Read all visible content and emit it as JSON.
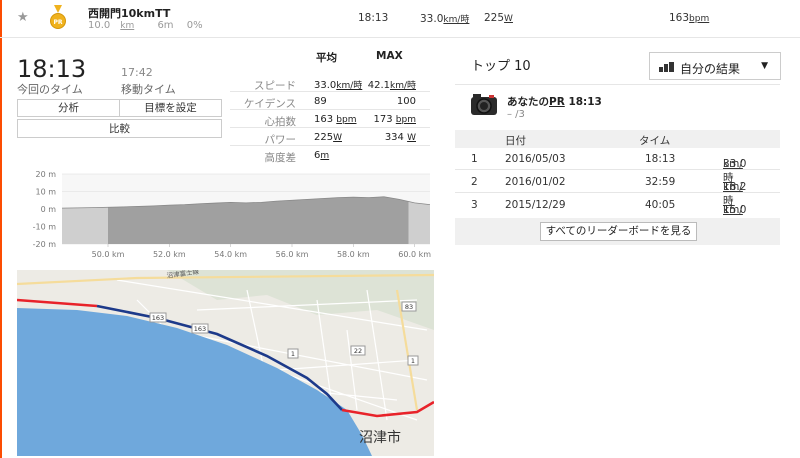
{
  "segment": {
    "name": "西開門10kmTT",
    "distance": "10.0",
    "distance_unit": "km",
    "elev_gain": "6m",
    "grade": "0%",
    "time": "18:13",
    "speed": "33.0",
    "speed_unit": "km/時",
    "power": "225",
    "power_unit": "W",
    "heart_rate": "163",
    "hr_unit": "bpm",
    "medal_label": "PR"
  },
  "summary": {
    "elapsed_time": "18:13",
    "elapsed_label": "今回のタイム",
    "moving_time": "17:42",
    "moving_label": "移動タイム",
    "buttons": {
      "analyze": "分析",
      "set_goal": "目標を設定",
      "compare": "比較"
    }
  },
  "stats": {
    "avg_header": "平均",
    "max_header": "MAX",
    "rows": [
      {
        "label": "スピード",
        "avg": "33.0",
        "avg_unit": "km/時",
        "max": "42.1",
        "max_unit": "km/時"
      },
      {
        "label": "ケイデンス",
        "avg": "89",
        "avg_unit": "",
        "max": "100",
        "max_unit": ""
      },
      {
        "label": "心拍数",
        "avg": "163",
        "avg_unit": "bpm",
        "max": "173",
        "max_unit": "bpm"
      },
      {
        "label": "パワー",
        "avg": "225",
        "avg_unit": "W",
        "max": "334",
        "max_unit": "W"
      },
      {
        "label": "高度差",
        "avg": "6",
        "avg_unit": "m",
        "max": "",
        "max_unit": ""
      }
    ]
  },
  "chart_data": {
    "type": "area",
    "x": [
      48.5,
      49.5,
      50.0,
      50.5,
      51.0,
      51.5,
      52.0,
      52.5,
      53.0,
      53.5,
      54.0,
      54.5,
      55.0,
      55.5,
      56.0,
      56.5,
      57.0,
      57.5,
      58.0,
      58.5,
      59.0,
      59.5,
      60.0,
      60.5
    ],
    "y": [
      0.5,
      0.8,
      1.0,
      1.2,
      1.5,
      1.8,
      2.2,
      2.5,
      3.0,
      3.4,
      3.8,
      3.5,
      3.8,
      4.5,
      5.0,
      5.5,
      6.0,
      6.5,
      6.8,
      6.5,
      7.0,
      5.5,
      3.5,
      2.5
    ],
    "xlabel": "",
    "ylabel": "",
    "xlim": [
      48.5,
      60.5
    ],
    "ylim": [
      -20,
      20
    ],
    "x_ticks": [
      "50.0 km",
      "52.0 km",
      "54.0 km",
      "56.0 km",
      "58.0 km",
      "60.0 km"
    ],
    "y_ticks": [
      "20 m",
      "10 m",
      "0 m",
      "-10 m",
      "-20 m"
    ],
    "highlight_range": [
      50.0,
      59.8
    ],
    "grid": true,
    "fill_color": "#a0a0a0",
    "context_color": "#cfcfcf"
  },
  "map": {
    "labels": [
      "163",
      "163",
      "1",
      "22",
      "83",
      "1"
    ],
    "city": "沼津市",
    "road_label": "沼津富士線",
    "route_color": "#1d3a8a",
    "offroute_color": "#e8232a",
    "sea_color": "#6fa8dc"
  },
  "leaderboard": {
    "title": "トップ 10",
    "dropdown": "自分の結果",
    "pr_title_prefix": "あなたの",
    "pr_word": "PR",
    "pr_time": "18:13",
    "pr_rank": "– /3",
    "headers": {
      "date": "日付",
      "time": "タイム"
    },
    "rows": [
      {
        "rank": "1",
        "date": "2016/05/03",
        "time": "18:13",
        "speed": "33.0",
        "unit": "km/時"
      },
      {
        "rank": "2",
        "date": "2016/01/02",
        "time": "32:59",
        "speed": "18.2",
        "unit": "km/時"
      },
      {
        "rank": "3",
        "date": "2015/12/29",
        "time": "40:05",
        "speed": "15.0",
        "unit": "km/時"
      }
    ],
    "view_all": "すべてのリーダーボードを見る"
  },
  "colors": {
    "accent": "#fc4c02",
    "medal": "#f0b21d"
  }
}
